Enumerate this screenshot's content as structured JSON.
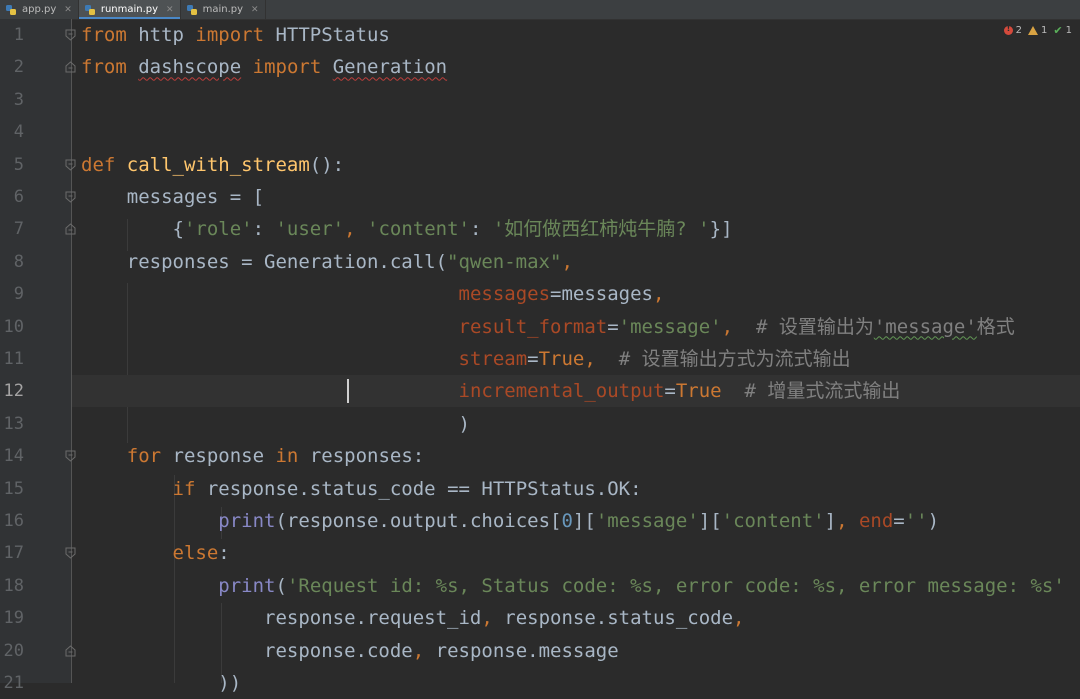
{
  "tabs": [
    {
      "label": "app.py",
      "active": false
    },
    {
      "label": "runmain.py",
      "active": true
    },
    {
      "label": "main.py",
      "active": false
    }
  ],
  "inspections": {
    "errors": "2",
    "warnings": "1",
    "weak_warnings": "1"
  },
  "current_line": 12,
  "colors": {
    "background": "#2b2b2b",
    "gutter": "#313335",
    "keyword": "#cc7832",
    "string": "#6a8759",
    "function": "#ffc66d",
    "builtin": "#8888c6",
    "parameter": "#aa4926",
    "number": "#6897bb",
    "comment": "#808080",
    "text": "#a9b7c6"
  },
  "code_lines": [
    {
      "n": "1",
      "tokens": [
        [
          "kw",
          "from"
        ],
        [
          "plain",
          " http "
        ],
        [
          "kw",
          "import"
        ],
        [
          "plain",
          " HTTPStatus"
        ]
      ]
    },
    {
      "n": "2",
      "tokens": [
        [
          "kw",
          "from"
        ],
        [
          "plain",
          " "
        ],
        [
          "plain wavy-red",
          "dashscope"
        ],
        [
          "plain",
          " "
        ],
        [
          "kw",
          "import"
        ],
        [
          "plain",
          " "
        ],
        [
          "plain wavy-red",
          "Generation"
        ]
      ]
    },
    {
      "n": "3",
      "tokens": []
    },
    {
      "n": "4",
      "tokens": []
    },
    {
      "n": "5",
      "tokens": [
        [
          "kw",
          "def "
        ],
        [
          "fn",
          "call_with_stream"
        ],
        [
          "plain",
          "():"
        ]
      ]
    },
    {
      "n": "6",
      "tokens": [
        [
          "plain",
          "    messages = ["
        ]
      ]
    },
    {
      "n": "7",
      "tokens": [
        [
          "plain",
          "        {"
        ],
        [
          "str",
          "'role'"
        ],
        [
          "plain",
          ": "
        ],
        [
          "str",
          "'user'"
        ],
        [
          "kw",
          ", "
        ],
        [
          "str",
          "'content'"
        ],
        [
          "plain",
          ": "
        ],
        [
          "str",
          "'如何做西红柿炖牛腩? '"
        ],
        [
          "plain",
          "}]"
        ]
      ]
    },
    {
      "n": "8",
      "tokens": [
        [
          "plain",
          "    responses = Generation.call("
        ],
        [
          "str",
          "\"qwen-max\""
        ],
        [
          "kw",
          ","
        ]
      ]
    },
    {
      "n": "9",
      "tokens": [
        [
          "plain",
          "                                 "
        ],
        [
          "param",
          "messages"
        ],
        [
          "plain",
          "=messages"
        ],
        [
          "kw",
          ","
        ]
      ]
    },
    {
      "n": "10",
      "tokens": [
        [
          "plain",
          "                                 "
        ],
        [
          "param",
          "result_format"
        ],
        [
          "plain",
          "="
        ],
        [
          "str",
          "'message'"
        ],
        [
          "kw",
          ","
        ],
        [
          "cmt",
          "  # 设置输出为"
        ],
        [
          "cmt wavy-green",
          "'message'"
        ],
        [
          "cmt",
          "格式"
        ]
      ]
    },
    {
      "n": "11",
      "tokens": [
        [
          "plain",
          "                                 "
        ],
        [
          "param",
          "stream"
        ],
        [
          "plain",
          "="
        ],
        [
          "kw",
          "True"
        ],
        [
          "kw",
          ","
        ],
        [
          "cmt",
          "  # 设置输出方式为流式输出"
        ]
      ]
    },
    {
      "n": "12",
      "tokens": [
        [
          "plain",
          "                                 "
        ],
        [
          "param",
          "incremental_output"
        ],
        [
          "plain",
          "="
        ],
        [
          "kw",
          "True"
        ],
        [
          "cmt",
          "  # 增量式流式输出"
        ]
      ]
    },
    {
      "n": "13",
      "tokens": [
        [
          "plain",
          "                                 )"
        ]
      ]
    },
    {
      "n": "14",
      "tokens": [
        [
          "plain",
          "    "
        ],
        [
          "kw",
          "for"
        ],
        [
          "plain",
          " response "
        ],
        [
          "kw",
          "in"
        ],
        [
          "plain",
          " responses:"
        ]
      ]
    },
    {
      "n": "15",
      "tokens": [
        [
          "plain",
          "        "
        ],
        [
          "kw",
          "if"
        ],
        [
          "plain",
          " response.status_code == HTTPStatus.OK:"
        ]
      ]
    },
    {
      "n": "16",
      "tokens": [
        [
          "plain",
          "            "
        ],
        [
          "builtin",
          "print"
        ],
        [
          "plain",
          "(response.output.choices["
        ],
        [
          "num",
          "0"
        ],
        [
          "plain",
          "]["
        ],
        [
          "str",
          "'message'"
        ],
        [
          "plain",
          "]["
        ],
        [
          "str",
          "'content'"
        ],
        [
          "plain",
          "]"
        ],
        [
          "kw",
          ", "
        ],
        [
          "param",
          "end"
        ],
        [
          "plain",
          "="
        ],
        [
          "str",
          "''"
        ],
        [
          "plain",
          ")"
        ]
      ]
    },
    {
      "n": "17",
      "tokens": [
        [
          "plain",
          "        "
        ],
        [
          "kw",
          "else"
        ],
        [
          "plain",
          ":"
        ]
      ]
    },
    {
      "n": "18",
      "tokens": [
        [
          "plain",
          "            "
        ],
        [
          "builtin",
          "print"
        ],
        [
          "plain",
          "("
        ],
        [
          "str",
          "'Request id: %s, Status code: %s, error code: %s, error message: %s'"
        ]
      ]
    },
    {
      "n": "19",
      "tokens": [
        [
          "plain",
          "                response.request_id"
        ],
        [
          "kw",
          ", "
        ],
        [
          "plain",
          "response.status_code"
        ],
        [
          "kw",
          ","
        ]
      ]
    },
    {
      "n": "20",
      "tokens": [
        [
          "plain",
          "                response.code"
        ],
        [
          "kw",
          ", "
        ],
        [
          "plain",
          "response.message"
        ]
      ]
    },
    {
      "n": "21",
      "tokens": [
        [
          "plain",
          "            ))"
        ]
      ]
    }
  ],
  "folds": {
    "1": "open",
    "2": "close",
    "5": "open",
    "6": "open",
    "7": "close",
    "14": "open",
    "17": "open",
    "20": "close"
  }
}
